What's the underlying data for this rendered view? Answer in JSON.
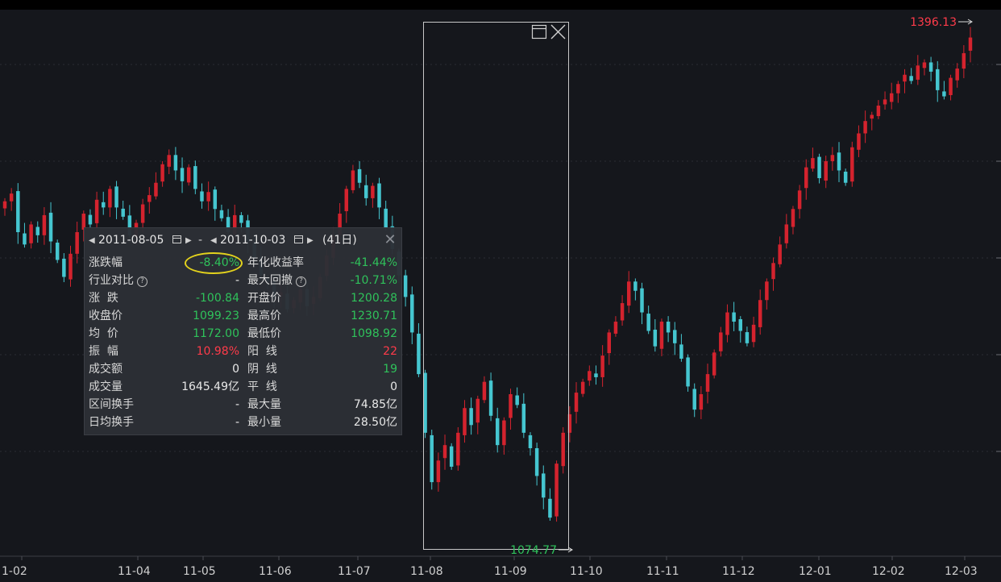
{
  "chart_data": {
    "type": "candlestick",
    "x_tick_labels": [
      "1-02",
      "11-04",
      "11-05",
      "11-06",
      "11-07",
      "11-08",
      "11-09",
      "11-10",
      "11-11",
      "11-12",
      "12-01",
      "12-02",
      "12-03"
    ],
    "ylim": [
      1060,
      1410
    ],
    "grid": true,
    "high_marker": {
      "label": "1396.13",
      "value": 1396.13,
      "color": "#ff3b4a"
    },
    "low_marker": {
      "label": "1074.77",
      "value": 1074.77,
      "color": "#2fc25b"
    },
    "selection_range": {
      "from": "2011-08-05",
      "to": "2011-10-03"
    },
    "up_color": "#d4232e",
    "down_color": "#45c6d0",
    "closes": [
      1290,
      1295,
      1270,
      1262,
      1275,
      1268,
      1281,
      1264,
      1252,
      1241,
      1256,
      1270,
      1282,
      1275,
      1291,
      1286,
      1298,
      1286,
      1280,
      1268,
      1276,
      1288,
      1294,
      1302,
      1314,
      1320,
      1310,
      1303,
      1312,
      1298,
      1290,
      1296,
      1285,
      1279,
      1270,
      1281,
      1276,
      1264,
      1253,
      1242,
      1238,
      1227,
      1231,
      1220,
      1226,
      1233,
      1222,
      1228,
      1241,
      1255,
      1268,
      1282,
      1298,
      1310,
      1302,
      1292,
      1300,
      1286,
      1273,
      1259,
      1242,
      1228,
      1205,
      1178,
      1140,
      1108,
      1122,
      1132,
      1118,
      1140,
      1156,
      1145,
      1162,
      1173,
      1151,
      1132,
      1148,
      1165,
      1158,
      1140,
      1130,
      1112,
      1098,
      1085,
      1120,
      1140,
      1152,
      1166,
      1173,
      1180,
      1176,
      1190,
      1205,
      1212,
      1224,
      1238,
      1232,
      1218,
      1206,
      1196,
      1212,
      1205,
      1198,
      1188,
      1170,
      1155,
      1165,
      1178,
      1192,
      1205,
      1218,
      1212,
      1206,
      1198,
      1210,
      1226,
      1238,
      1250,
      1262,
      1275,
      1285,
      1297,
      1312,
      1318,
      1305,
      1316,
      1320,
      1310,
      1302,
      1325,
      1334,
      1342,
      1346,
      1352,
      1356,
      1360,
      1366,
      1372,
      1368,
      1378,
      1380,
      1374,
      1362,
      1358,
      1370,
      1376,
      1386,
      1396.13
    ]
  },
  "stats_panel": {
    "start_date": "2011-08-05",
    "dash": "-",
    "end_date": "2011-10-03",
    "day_count": "(41日)",
    "rows": [
      {
        "label_left": "涨跌幅",
        "value_left": "-8.40%",
        "label_right": "年化收益率",
        "value_right": "-41.44%"
      },
      {
        "label_left": "行业对比",
        "value_left": "-",
        "label_right": "最大回撤",
        "value_right": "-10.71%"
      },
      {
        "label_left": "涨  跌",
        "value_left": "-100.84",
        "label_right": "开盘价",
        "value_right": "1200.28"
      },
      {
        "label_left": "收盘价",
        "value_left": "1099.23",
        "label_right": "最高价",
        "value_right": "1230.71"
      },
      {
        "label_left": "均  价",
        "value_left": "1172.00",
        "label_right": "最低价",
        "value_right": "1098.92"
      },
      {
        "label_left": "振  幅",
        "value_left": "10.98%",
        "label_right": "阳  线",
        "value_right": "22"
      },
      {
        "label_left": "成交额",
        "value_left": "0",
        "label_right": "阴  线",
        "value_right": "19"
      },
      {
        "label_left": "成交量",
        "value_left": "1645.49亿",
        "label_right": "平  线",
        "value_right": "0"
      },
      {
        "label_left": "区间换手",
        "value_left": "-",
        "label_right": "最大量",
        "value_right": "74.85亿"
      },
      {
        "label_left": "日均换手",
        "value_left": "-",
        "label_right": "最小量",
        "value_right": "28.50亿"
      }
    ],
    "help_icon_glyph": "?",
    "close_icon_glyph": "✕"
  }
}
